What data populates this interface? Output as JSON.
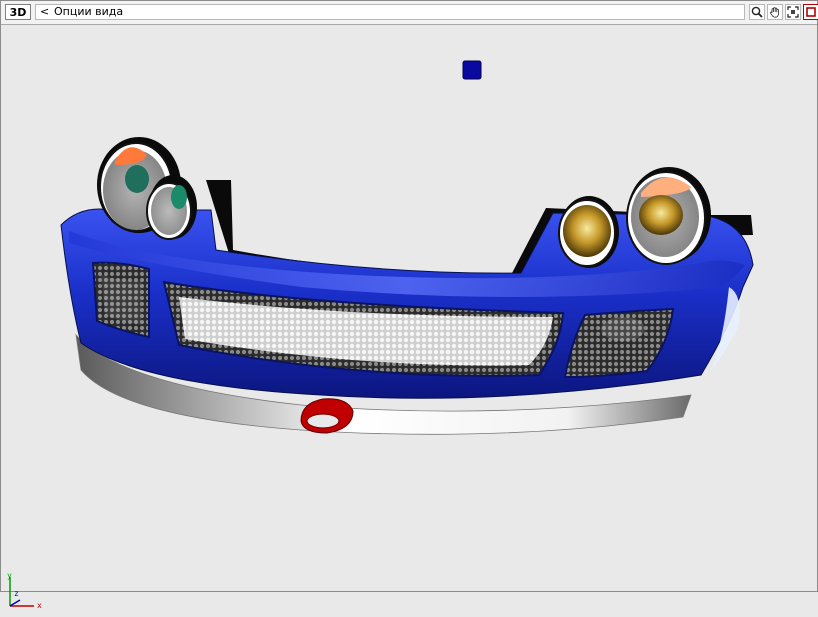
{
  "toolbar": {
    "view_mode": "3D",
    "back_glyph": "<",
    "options_label": "Опции вида",
    "tools": [
      "zoom-icon",
      "pan-hand-icon",
      "fit-view-icon",
      "maximize-icon"
    ]
  },
  "viewport": {
    "axis": {
      "y": "y",
      "z": "z",
      "x": "x"
    }
  },
  "colors": {
    "background": "#e9e9e9",
    "bumper_blue": "#1a2fc8",
    "tow_hook": "#c00000",
    "axis_y": "#00a000",
    "axis_z": "#0000c0",
    "axis_x": "#c00000"
  }
}
